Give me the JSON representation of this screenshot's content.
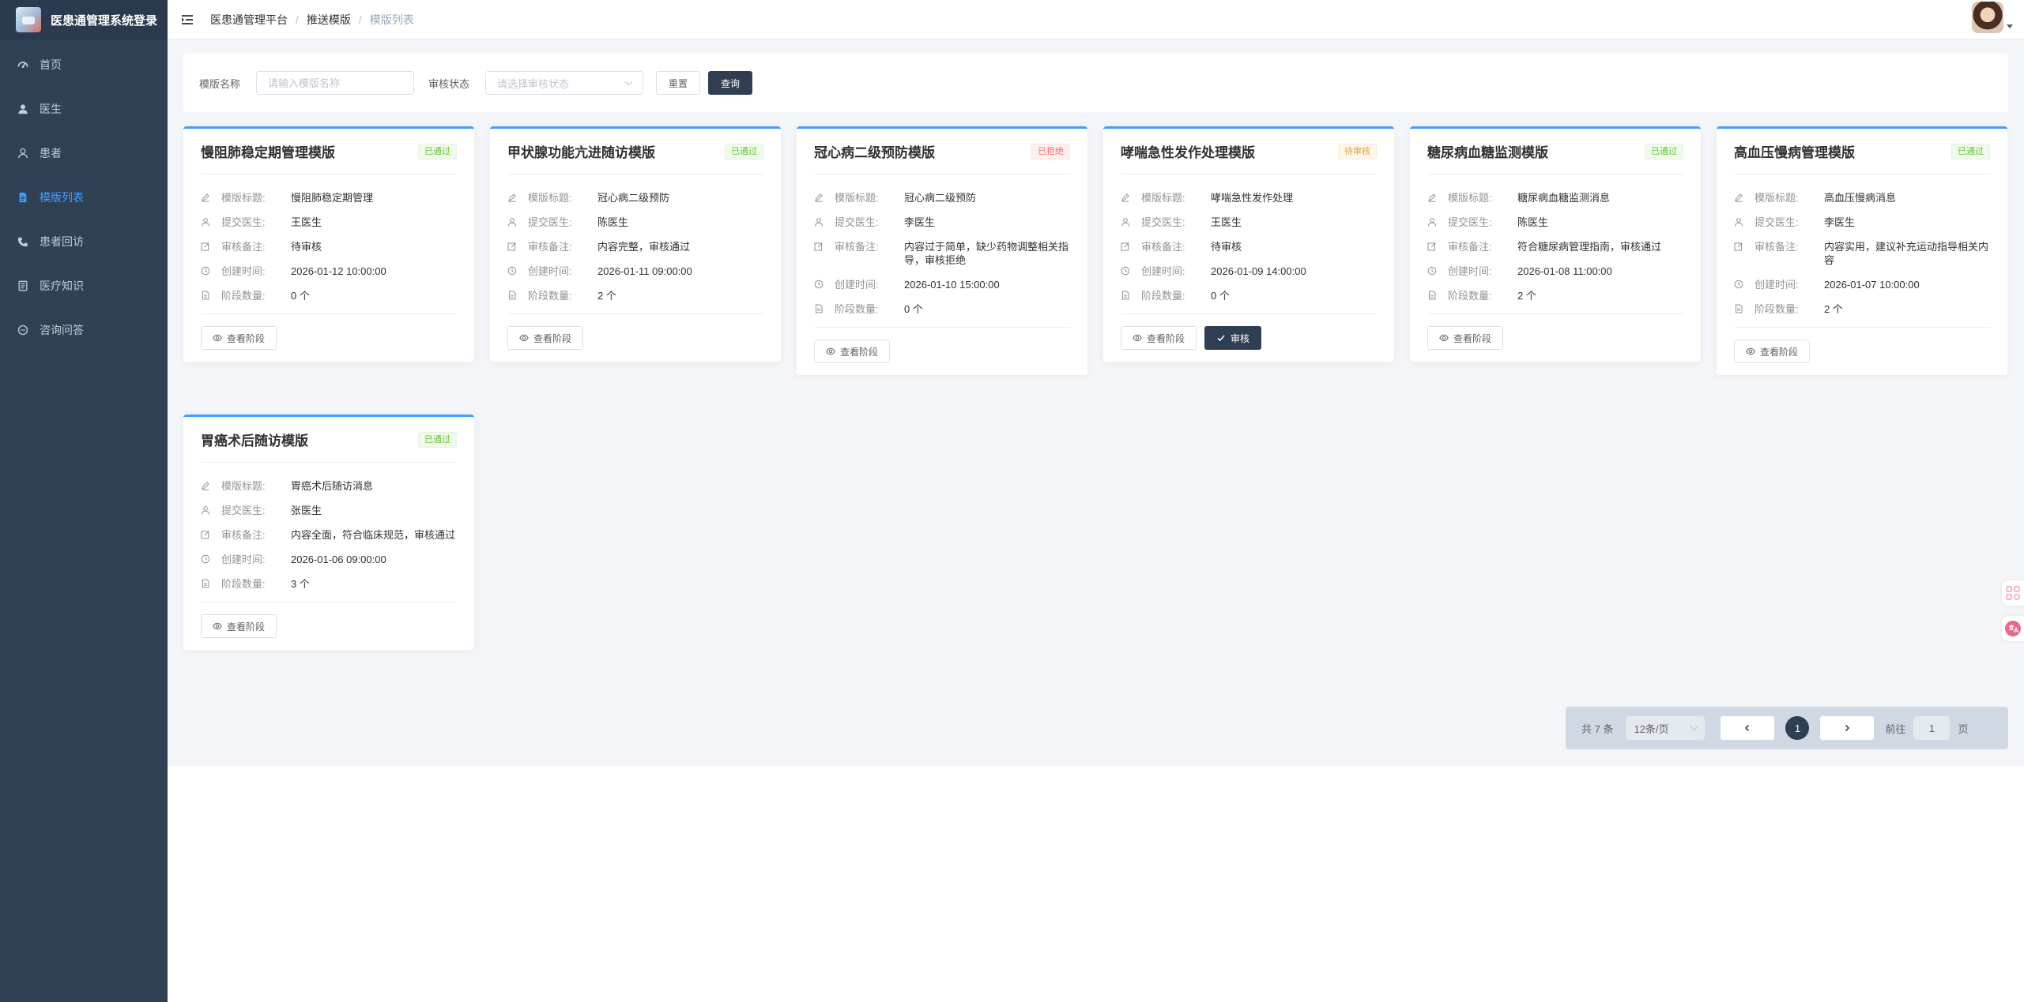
{
  "brand": {
    "title": "医患通管理系统登录"
  },
  "sidebar": {
    "items": [
      {
        "label": "首页",
        "icon": "dashboard-icon"
      },
      {
        "label": "医生",
        "icon": "user-solid-icon"
      },
      {
        "label": "患者",
        "icon": "user-icon"
      },
      {
        "label": "模版列表",
        "icon": "document-icon",
        "active": true
      },
      {
        "label": "患者回访",
        "icon": "phone-icon"
      },
      {
        "label": "医疗知识",
        "icon": "book-icon"
      },
      {
        "label": "咨询问答",
        "icon": "chat-icon"
      }
    ]
  },
  "header": {
    "breadcrumb": [
      "医患通管理平台",
      "推送模版",
      "模版列表"
    ],
    "separator": "/"
  },
  "filter": {
    "name_label": "模版名称",
    "name_placeholder": "请输入模版名称",
    "status_label": "审核状态",
    "status_placeholder": "请选择审核状态",
    "reset_label": "重置",
    "query_label": "查询"
  },
  "labels": {
    "title": "模版标题:",
    "doctor": "提交医生:",
    "remark": "审核备注:",
    "created": "创建时间:",
    "stages": "阶段数量:",
    "view_stages": "查看阶段",
    "review": "审核"
  },
  "cards": [
    {
      "name": "慢阻肺稳定期管理模版",
      "status": "已通过",
      "status_type": "ok",
      "title": "慢阻肺稳定期管理",
      "doctor": "王医生",
      "remark": "待审核",
      "created": "2026-01-12 10:00:00",
      "stages": "0 个"
    },
    {
      "name": "甲状腺功能亢进随访模版",
      "status": "已通过",
      "status_type": "ok",
      "title": "冠心病二级预防",
      "doctor": "陈医生",
      "remark": "内容完整，审核通过",
      "created": "2026-01-11 09:00:00",
      "stages": "2 个"
    },
    {
      "name": "冠心病二级预防模版",
      "status": "已拒绝",
      "status_type": "rej",
      "title": "冠心病二级预防",
      "doctor": "李医生",
      "remark": "内容过于简单，缺少药物调整相关指导，审核拒绝",
      "created": "2026-01-10 15:00:00",
      "stages": "0 个"
    },
    {
      "name": "哮喘急性发作处理模版",
      "status": "待审核",
      "status_type": "pend",
      "title": "哮喘急性发作处理",
      "doctor": "王医生",
      "remark": "待审核",
      "created": "2026-01-09 14:00:00",
      "stages": "0 个"
    },
    {
      "name": "糖尿病血糖监测模版",
      "status": "已通过",
      "status_type": "ok",
      "title": "糖尿病血糖监测消息",
      "doctor": "陈医生",
      "remark": "符合糖尿病管理指南，审核通过",
      "created": "2026-01-08 11:00:00",
      "stages": "2 个"
    },
    {
      "name": "高血压慢病管理模版",
      "status": "已通过",
      "status_type": "ok",
      "title": "高血压慢病消息",
      "doctor": "李医生",
      "remark": "内容实用，建议补充运动指导相关内容",
      "created": "2026-01-07 10:00:00",
      "stages": "2 个"
    },
    {
      "name": "胃癌术后随访模版",
      "status": "已通过",
      "status_type": "ok",
      "title": "胃癌术后随访消息",
      "doctor": "张医生",
      "remark": "内容全面，符合临床规范，审核通过",
      "created": "2026-01-06 09:00:00",
      "stages": "3 个"
    }
  ],
  "pagination": {
    "total": "共 7 条",
    "page_size": "12条/页",
    "current": "1",
    "goto_label": "前往",
    "goto_value": "1",
    "page_unit": "页"
  },
  "colors": {
    "sidebar_bg": "#304156",
    "active": "#409eff",
    "primary_dark": "#2f3e52",
    "success": "#67c23a",
    "danger": "#f56c6c",
    "warning": "#e6a23c"
  }
}
